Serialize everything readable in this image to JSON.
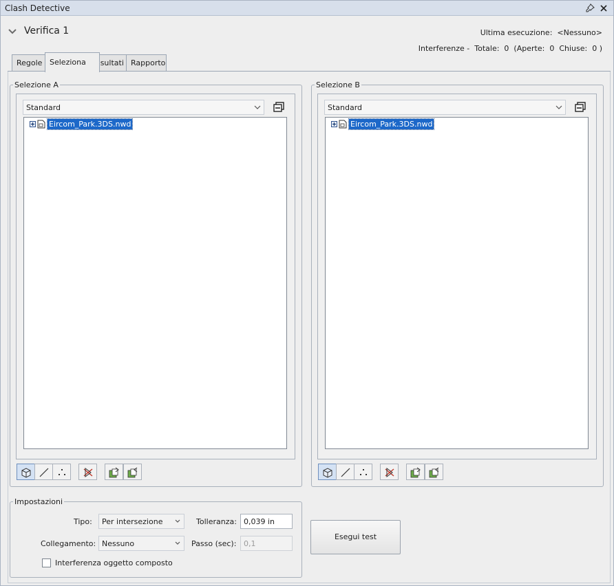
{
  "window": {
    "title": "Clash Detective"
  },
  "header": {
    "test_name": "Verifica 1",
    "last_run_label": "Ultima esecuzione:",
    "last_run_value": "<Nessuno>",
    "clashes_label": "Interferenze -",
    "total_label": "Totale:",
    "total_value": "0",
    "open_label": "(Aperte:",
    "open_value": "0",
    "closed_label": "Chiuse:",
    "closed_value": "0 )"
  },
  "tabs": [
    {
      "label": "Regole"
    },
    {
      "label": "Seleziona"
    },
    {
      "label": "Risultati"
    },
    {
      "label": "Rapporto"
    }
  ],
  "selection_a": {
    "title": "Selezione A",
    "view_mode": "Standard",
    "tree_item": "Eircom_Park.3DS.nwd"
  },
  "selection_b": {
    "title": "Selezione B",
    "view_mode": "Standard",
    "tree_item": "Eircom_Park.3DS.nwd"
  },
  "settings": {
    "title": "Impostazioni",
    "type_label": "Tipo:",
    "type_value": "Per intersezione",
    "tolerance_label": "Tolleranza:",
    "tolerance_value": "0,039 in",
    "link_label": "Collegamento:",
    "link_value": "Nessuno",
    "step_label": "Passo (sec):",
    "step_value": "0,1",
    "composite_label": "Interferenza oggetto composto",
    "composite_checked": false
  },
  "run_button": "Esegui test"
}
